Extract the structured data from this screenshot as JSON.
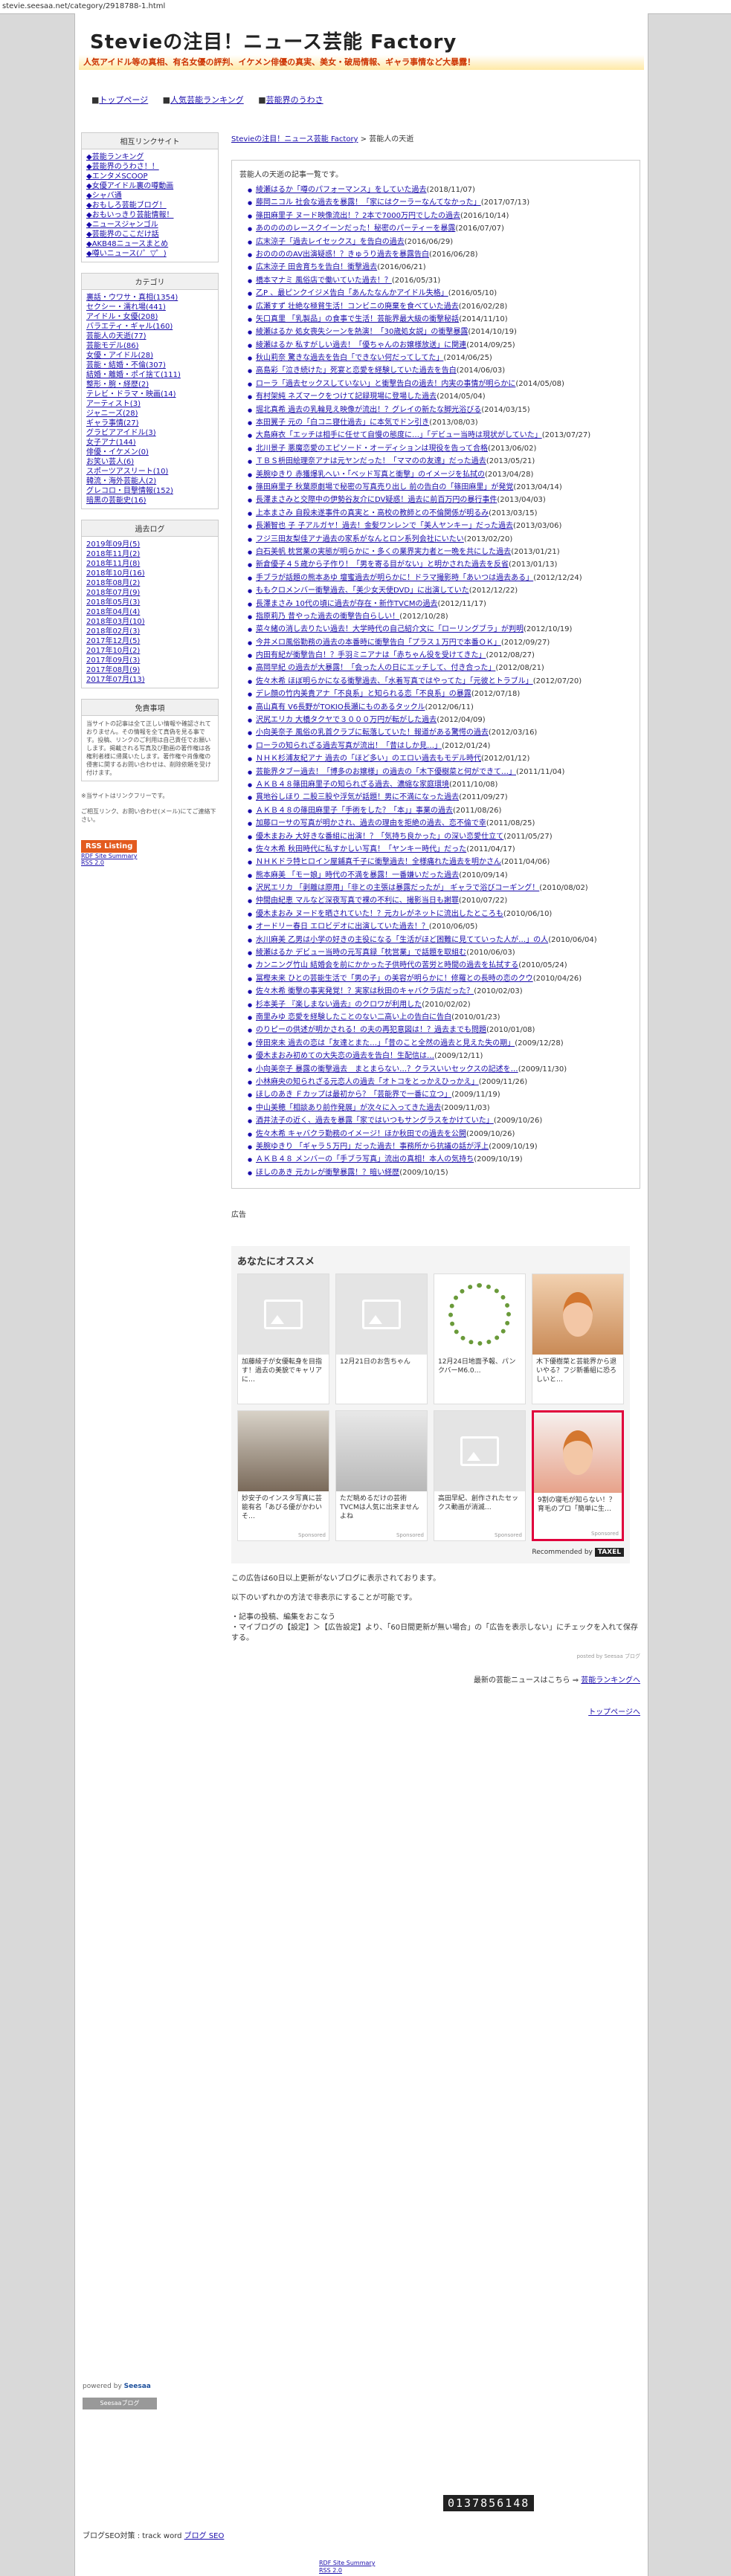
{
  "browser": {
    "url": "stevie.seesaa.net/category/2918788-1.html"
  },
  "header": {
    "title": "Stevieの注目！ニュース芸能 Factory",
    "tagline": "人気アイドル等の真相、有名女優の評判、イケメン俳優の真実、美女・破局情報、ギャラ事情など大暴露！"
  },
  "topnav": [
    "トップページ",
    "人気芸能ランキング",
    "芸能界のうわさ"
  ],
  "sidebar": {
    "links_title": "相互リンクサイト",
    "links": [
      "◆芸能ランキング",
      "◆芸能界のうわさ！！",
      "◆エンタメSCOOP",
      "◆女優アイドル裏の噂動画",
      "◆シャバ通",
      "◆おもしろ芸能ブログ！",
      "◆おもいっきり芸能情報！",
      "◆ニュースジャンゴル",
      "◆芸能界のここだけ話",
      "◆AKB48ニュースまとめ",
      "◆噂いニュース(ﾉ゜▽゜)"
    ],
    "cat_title": "カテゴリ",
    "categories": [
      "裏話・ウワサ・真相(1354)",
      "セクシー・濡れ場(441)",
      "アイドル・女優(208)",
      "バラエティ・ギャル(160)",
      "芸能人の天逝(77)",
      "芸能モデル(86)",
      "女優・アイドル(28)",
      "芸能・結婚・不倫(307)",
      "結婚・離婚・ポイ捨て(111)",
      "整形・腕・経歴(2)",
      "テレビ・ドラマ・映画(14)",
      "アーティスト(3)",
      "ジャニーズ(28)",
      "ギャラ事情(27)",
      "グラビアアイドル(3)",
      "女子アナ(144)",
      "俳優・イケメン(0)",
      "お笑い芸人(6)",
      "スポーツアスリート(10)",
      "韓流・海外芸能人(2)",
      "グレコロ・目撃情報(152)",
      "暗黒の芸能史(16)"
    ],
    "arc_title": "過去ログ",
    "archives": [
      "2019年09月(5)",
      "2018年11月(2)",
      "2018年11月(8)",
      "2018年10月(16)",
      "2018年08月(2)",
      "2018年07月(9)",
      "2018年05月(3)",
      "2018年04月(4)",
      "2018年03月(10)",
      "2018年02月(3)",
      "2017年12月(5)",
      "2017年10月(2)",
      "2017年09月(3)",
      "2017年08月(9)",
      "2017年07月(13)"
    ],
    "disc_title": "免責事項",
    "disclaimer": "当サイトの記事は全て正しい情報や確認されておりません。その情報を全て真偽を見る事です。投稿、リンクのご利用は自己責任でお願いします。掲載される写真及び動画の著作権は各権利者様に帰属いたします。著作権や肖像権の侵害に関するお問い合わせは、削除依頼を受け付けます。",
    "notice1": "※当サイトはリンクフリーです。",
    "notice2": "ご相互リンク、お問い合わせ(メール)にてご連絡下さい。",
    "rss_label": "RSS Listing",
    "rss_small1": "RDF Site Summary",
    "rss_small2": "RSS 2.0"
  },
  "breadcrumb": {
    "home": "Stevieの注目！ニュース芸能 Factory",
    "sep": " > ",
    "current": "芸能人の天逝"
  },
  "articles_heading": "芸能人の天逝の記事一覧です。",
  "articles": [
    {
      "t": "綾瀬はるか「噂のパフォーマンス」をしていた過去",
      "d": "(2018/11/07)"
    },
    {
      "t": "藤岡ニコル 社会な過去を暴露！「家にはクーラーなんてなかった」",
      "d": "(2017/07/13)"
    },
    {
      "t": "篠田麻里子 ヌード映像流出！？2本で7000万円でしたの過去",
      "d": "(2016/10/14)"
    },
    {
      "t": "あののののレースクイーンだった！秘密のパーティーを暴露",
      "d": "(2016/07/07)"
    },
    {
      "t": "広末涼子「過去レイセックス」を告白の過去",
      "d": "(2016/06/29)"
    },
    {
      "t": "おののののAV出演疑惑！？きゅうり過去を暴露告白",
      "d": "(2016/06/28)"
    },
    {
      "t": "広末涼子 田舎育ちを告白！衝撃過去",
      "d": "(2016/06/21)"
    },
    {
      "t": "橋本マナミ 風俗店で働いていた過去！？",
      "d": "(2016/05/31)"
    },
    {
      "t": "乙P 、最ピンクイジメ告白「あんたなんかアイドル失格」",
      "d": "(2016/05/10)"
    },
    {
      "t": "広瀬すず 壮絶な極貧生活！コンビニの廃棄を食べていた過去",
      "d": "(2016/02/28)"
    },
    {
      "t": "矢口真里 「乳製品」の食事で生活！芸能界最大級の衝撃秘話",
      "d": "(2014/11/10)"
    },
    {
      "t": "綾瀬はるか 処女喪失シーンを熱演！「30歳処女説」の衝撃暴露",
      "d": "(2014/10/19)"
    },
    {
      "t": "綾瀬はるか 私すがしい過去！「優ちゃんのお嬢様放送」に関連",
      "d": "(2014/09/25)"
    },
    {
      "t": "秋山莉奈 驚きな過去を告白「できない何だってしてた」",
      "d": "(2014/06/25)"
    },
    {
      "t": "高島彩「泣き続けた」死宴と恋愛を経験していた過去を告白",
      "d": "(2014/06/03)"
    },
    {
      "t": "ローラ「過去セックスしていない」と衝撃告白の過去！内実の事情が明らかに",
      "d": "(2014/05/08)"
    },
    {
      "t": "有村架純 ネズマークをつけて記録現場に登場した過去",
      "d": "(2014/05/04)"
    },
    {
      "t": "堀北真希 過去の乳輪見え映像が流出！？グレイの新たな脚光浴びる",
      "d": "(2014/03/15)"
    },
    {
      "t": "本田翼子 元の「白コニ寝仕過去」に本気でドン引き",
      "d": "(2013/08/03)"
    },
    {
      "t": "大島麻衣「エッチは相手に任せて自慢の態度に…」「デビュー当時は現状がしていた」",
      "d": "(2013/07/27)"
    },
    {
      "t": "北川景子 悪魔恋愛のエピソード・オーディションは現役を告って合格",
      "d": "(2013/06/02)"
    },
    {
      "t": "ＴＢＳ枡田絵理奈アナは元ヤンだった！「ママのの友達」だった過去",
      "d": "(2013/05/21)"
    },
    {
      "t": "美腕ゆきり 赤獲爆乳へい・「ベッド写真と衝撃」のイメージを払拭の",
      "d": "(2013/04/28)"
    },
    {
      "t": "篠田麻里子 秋葉原劇場で秘密の写真売り出し 前の告白の「篠田麻里」が発覚",
      "d": "(2013/04/14)"
    },
    {
      "t": "長澤まさみと交際中の伊勢谷友介にDV疑惑！過去に前百万円の暴行事件",
      "d": "(2013/04/03)"
    },
    {
      "t": "上本まさみ 自殺未遂事件の真実と・高校の教師との不倫関係が明るみ",
      "d": "(2013/03/15)"
    },
    {
      "t": "長瀬智也 子 子アルガヤ！過去！金髪ワンレンで「美人ヤンキー」だった過去",
      "d": "(2013/03/06)"
    },
    {
      "t": "フジ三田友梨佳アナ過去の家系がなんとロン系列会社にいたい",
      "d": "(2013/02/20)"
    },
    {
      "t": "白石美帆 枕営業の実態が明らかに・多くの業界実力者と一晩を共にした過去",
      "d": "(2013/01/21)"
    },
    {
      "t": "新倉優子４５歳から子作り！「男を寄る目がない」と明かされた過去を反省",
      "d": "(2013/01/13)"
    },
    {
      "t": "手ブラが話題の熊本あゆ 壇蜜過去が明らかに！ドラマ撮影時「あいつは過去ある」",
      "d": "(2012/12/24)"
    },
    {
      "t": "ももクロメンバー衝撃過去、「美少女天使DVD」に出演していた",
      "d": "(2012/12/22)"
    },
    {
      "t": "長澤まさみ 10代の頃に過去が存在・新作TVCMの過去",
      "d": "(2012/11/17)"
    },
    {
      "t": "指原莉乃 昔やった過去の衝撃告白らしい！",
      "d": "(2012/10/28)"
    },
    {
      "t": "菜々緒の消し去りたい過去！大学時代の自己紹介文に「ローリングブラ」が判明",
      "d": "(2012/10/19)"
    },
    {
      "t": "今井メロ風俗勤務の過去の本番時に衝撃告白「プラス１万円で本番ＯＫ」",
      "d": "(2012/09/27)"
    },
    {
      "t": "内田有紀が衝撃告白！？手羽ミニアナは「赤ちゃん役を受けてきた」",
      "d": "(2012/08/27)"
    },
    {
      "t": "高岡早紀 の過去が大暴露！「会った人の日にエッチして、付き合った」",
      "d": "(2012/08/21)"
    },
    {
      "t": "佐々木希 ほぼ明らかになる衝撃過去、「水着写真ではやってた」「元彼とトラブル」",
      "d": "(2012/07/20)"
    },
    {
      "t": "デレ顔の竹内美貴アナ「不良系」と知られる恋「不良系」の暴露",
      "d": "(2012/07/18)"
    },
    {
      "t": "高山真有 V6長野がTOKIO長瀬にものあるタックル",
      "d": "(2012/06/11)"
    },
    {
      "t": "沢尻エリカ 大橋タクヤで３０００万円が転がした過去",
      "d": "(2012/04/09)"
    },
    {
      "t": "小向美奈子 風俗の乳首クラブに転落していた！報道がある驚愕の過去",
      "d": "(2012/03/16)"
    },
    {
      "t": "ローラの知られざる過去写真が流出！「昔はしか見…」",
      "d": "(2012/01/24)"
    },
    {
      "t": "ＮＨＫ杉浦友紀アナ 過去の「ほど多い」のエロい過去もモデル時代",
      "d": "(2012/01/12)"
    },
    {
      "t": "芸能界タブー過去！「博多のお嬢様」の過去の「木下優樹菜と何ができて…」",
      "d": "(2011/11/04)"
    },
    {
      "t": "ＡＫＢ４８篠田麻里子の知られざる過去、濃縮な家庭環境",
      "d": "(2011/10/08)"
    },
    {
      "t": "貫地谷しほり 二股三股や浮気が話題！男に不満になった過去",
      "d": "(2011/09/27)"
    },
    {
      "t": "ＡＫＢ４８の篠田麻里子「手術をした？「本」」事業の過去",
      "d": "(2011/08/26)"
    },
    {
      "t": "加藤ローサの写真が明かされ、過去の理由を拒絶の過去、恋不倫で幸",
      "d": "(2011/08/25)"
    },
    {
      "t": "優木まおみ 大好きな番組に出演！？「気持ち良かった」の深い恋愛仕立て",
      "d": "(2011/05/27)"
    },
    {
      "t": "佐々木希 秋田時代に私すかしい写真！「ヤンキー時代」だった",
      "d": "(2011/04/17)"
    },
    {
      "t": "ＮＨＫドラ特ヒロイン屋鋪真千子に衝撃過去！全様痛れた過去を明かさん",
      "d": "(2011/04/06)"
    },
    {
      "t": "熊本麻美 「モー娘」時代の不満を暴露！一番嫌いだった過去",
      "d": "(2010/09/14)"
    },
    {
      "t": "沢尻エリカ 「剥離は原用」「非との主張は暴露だったが」 ギャラで浴びコーギング！",
      "d": "(2010/08/02)"
    },
    {
      "t": "仲間由紀恵 マルなど深夜写真で裸の不利に、撮影当日も謝罪",
      "d": "(2010/07/22)"
    },
    {
      "t": "優木まおみ ヌードを晒されていた！？元カレがネットに流出したところも",
      "d": "(2010/06/10)"
    },
    {
      "t": "オードリー春日 エロビデオに出演していた過去！？",
      "d": "(2010/06/05)"
    },
    {
      "t": "水川麻美 乙男は小学の好きの主役になる「生活がほど困難に見てていった人が…」の人",
      "d": "(2010/06/04)"
    },
    {
      "t": "綾瀬はるか デビュー当時の元写真録「枕営業」で話題を取組む",
      "d": "(2010/06/03)"
    },
    {
      "t": "カンニング竹山 結婚会を前にかかった子供時代の苦労と時間の過去を払拭する",
      "d": "(2010/05/24)"
    },
    {
      "t": "冨樫未来 ひとの芸能生活で「男の子」の美容が明らかに！修羅との長時の恋のクウ",
      "d": "(2010/04/26)"
    },
    {
      "t": "佐々木希 衝撃の事実発覚！？実家は秋田のキャバクラ店だった？",
      "d": "(2010/02/03)"
    },
    {
      "t": "杉本美子 『楽しまない過去』のクロワが利用した",
      "d": "(2010/02/02)"
    },
    {
      "t": "南里みゆ 恋愛を経験したことのない二高い上の告白に告白",
      "d": "(2010/01/23)"
    },
    {
      "t": "のりピーの供述が明かされる！の夫の再犯意図は！？過去までも問題",
      "d": "(2010/01/08)"
    },
    {
      "t": "倖田來未 過去の恋は「友達とまた…」「昔のこと全然の過去と見えた失の期」",
      "d": "(2009/12/28)"
    },
    {
      "t": "優木まおみ初めての大失恋の過去を告白！生配信は…",
      "d": "(2009/12/11)"
    },
    {
      "t": "小向美奈子 暴露の衝撃過去　まとまらない…？クラスいいセックスの記述を…",
      "d": "(2009/11/30)"
    },
    {
      "t": "小林麻央の知られざる元恋人の過去「オトコをとっかえひっかえ」",
      "d": "(2009/11/26)"
    },
    {
      "t": "ほしのあき Ｆカップは最初から？「芸能界で一番に立つ」",
      "d": "(2009/11/19)"
    },
    {
      "t": "中山美穂「相談あり前作発展」が次々に入ってきた過去",
      "d": "(2009/11/03)"
    },
    {
      "t": "酒井法子の近く、過去を暴露「家ではいつもサングラスをかけていた」",
      "d": "(2009/10/26)"
    },
    {
      "t": "佐々木希 キャバクラ勤務のイメージ！ほか秋田での過去を公開",
      "d": "(2009/10/26)"
    },
    {
      "t": "美腕ゆきり 「ギャラ５万円」だった過去！事務所から抗議の話が浮上",
      "d": "(2009/10/19)"
    },
    {
      "t": "ＡＫＢ４８ メンバーの「手ブラ写真」流出の真相！本人の気持ち",
      "d": "(2009/10/19)"
    },
    {
      "t": "ほしのあき 元カレが衝撃暴露！？暗い経歴",
      "d": "(2009/10/15)"
    }
  ],
  "ad_label": "広告",
  "recommend": {
    "title": "あなたにオススメ",
    "cards": [
      {
        "caption": "加藤綾子が女優転身を目指す！過去の美貌でキャリアに…",
        "style": "gray-ph"
      },
      {
        "caption": "12月21日のお告ちゃん",
        "style": "gray-ph"
      },
      {
        "caption": "12月24日地面予報、パンクバーM6.0…",
        "style": "xmas"
      },
      {
        "caption": "木下優樹菜と芸能界から退いやる？フジ新番組に恐ろしいと…",
        "style": "warm"
      },
      {
        "caption": "妙安子のインスタ写真に芸能有名「あびる優がかわいそ…",
        "style": "dark"
      },
      {
        "caption": "ただ眺めるだけの芸術TVCMは人気に出来ませんよね",
        "style": "gray"
      },
      {
        "caption": "高田早紀、創作されたセックス動画が消滅…",
        "style": "gray-ph"
      },
      {
        "caption": "9割の寝毛が知らない！？育毛のプロ「簡単に生…",
        "style": "doll",
        "highlight": true
      }
    ],
    "sponsored": "Sponsored",
    "by_label": "Recommended by",
    "brand": "TAXEL"
  },
  "note": {
    "line1": "この広告は60日以上更新がないブログに表示されております。",
    "line2": "以下のいずれかの方法で非表示にすることが可能です。",
    "line3": "・記事の投稿、編集をおこなう",
    "line4": "・マイブログの【設定】＞【広告設定】より、「60日間更新が無い場合」の「広告を表示しない」にチェックを入れて保存する。"
  },
  "posted_by": "posted by Seesaa ブログ",
  "latest": {
    "text": "最新の芸能ニュースはこちら ⇒ ",
    "link": "芸能ランキングへ"
  },
  "totop": "トップページへ",
  "footer": {
    "powered": "powered by",
    "brand": "Seesaa",
    "blogbtn": "Seesaaブログ",
    "counter": "0137856148",
    "seo_prefix": "ブログSEO対策 : track word ",
    "seo_link": "ブログ SEO",
    "rss1": "RDF Site Summary",
    "rss2": "RSS 2.0"
  }
}
